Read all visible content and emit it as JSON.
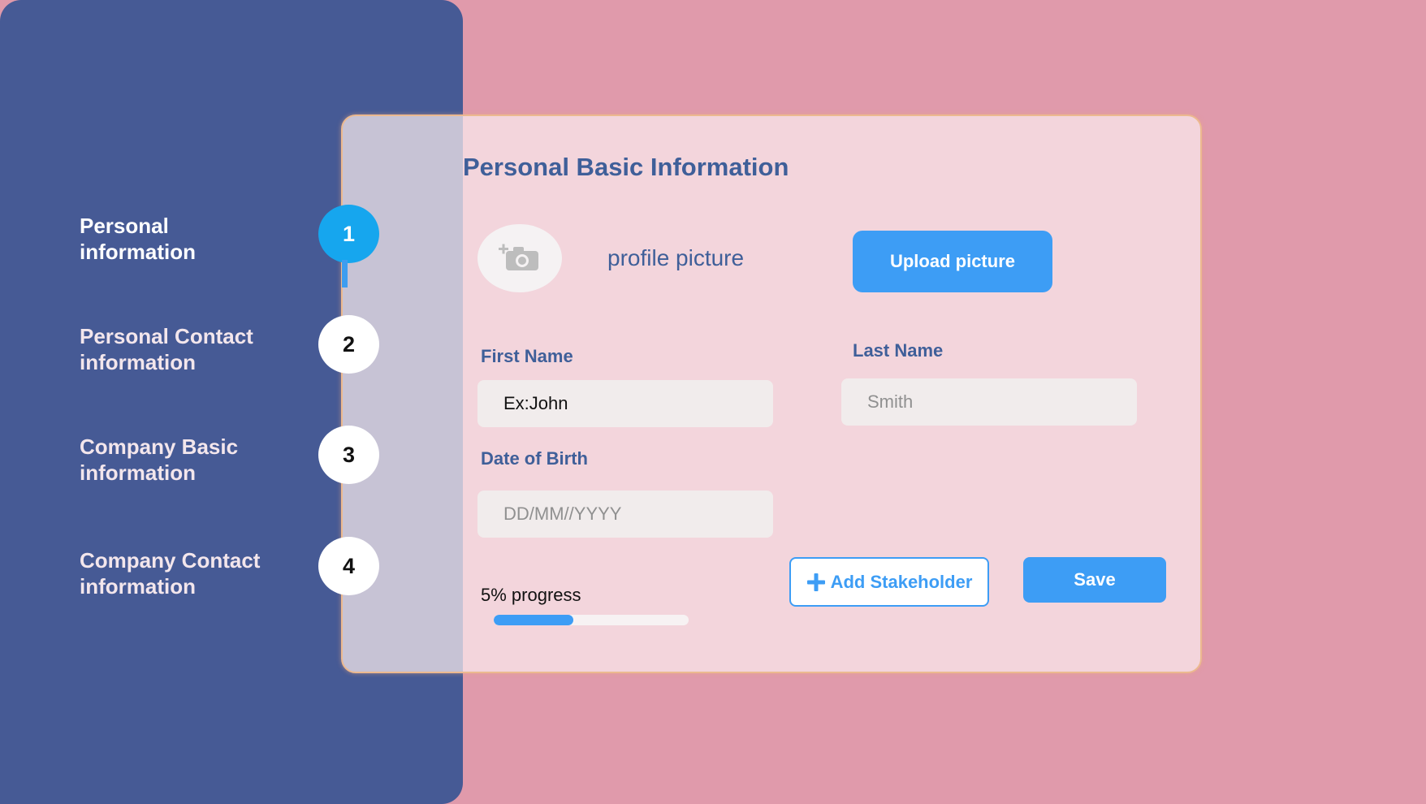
{
  "sidebar": {
    "steps": [
      {
        "line1": "Personal",
        "line2": "information",
        "number": "1"
      },
      {
        "line1": "Personal Contact",
        "line2": "information",
        "number": "2"
      },
      {
        "line1": "Company Basic",
        "line2": "information",
        "number": "3"
      },
      {
        "line1": "Company Contact",
        "line2": "information",
        "number": "4"
      }
    ]
  },
  "form": {
    "title": "Personal Basic Information",
    "profile_label": "profile picture",
    "upload_label": "Upload picture",
    "first_name": {
      "label": "First Name",
      "value": "Ex:John"
    },
    "last_name": {
      "label": "Last Name",
      "placeholder": "Smith"
    },
    "dob": {
      "label": "Date of Birth",
      "placeholder": "DD/MM//YYYY"
    },
    "progress": {
      "label": "5% progress",
      "fill_fraction": 0.41
    },
    "add_stakeholder_label": "Add Stakeholder",
    "save_label": "Save"
  },
  "icons": {
    "avatar": "camera-add-icon",
    "add": "plus-icon"
  },
  "colors": {
    "background": "#e09aab",
    "sidebar": "#465a95",
    "accent": "#3d9df5",
    "active_step": "#16a6ee",
    "heading": "#3f5f99"
  }
}
